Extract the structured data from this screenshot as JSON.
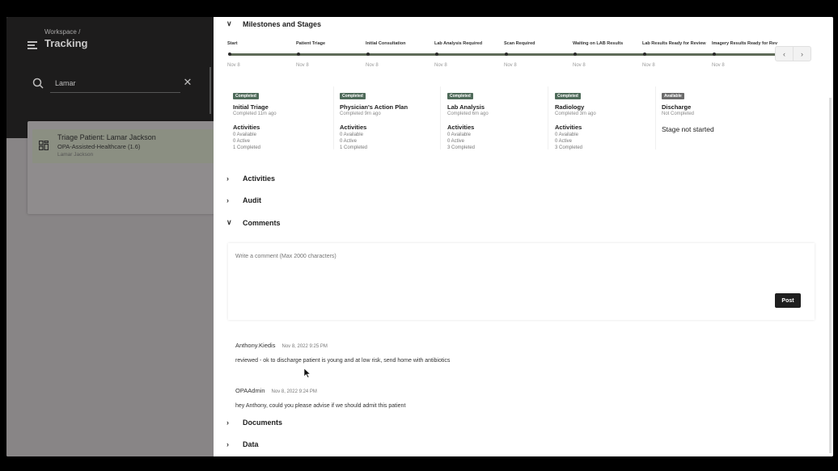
{
  "sidebar": {
    "breadcrumb": "Workspace /",
    "title": "Tracking",
    "search": {
      "value": "Lamar",
      "icon": "search-icon",
      "clear_icon": "close-icon"
    },
    "results": [
      {
        "title": "Triage Patient: Lamar Jackson",
        "process": "OPA-Assisted-Healthcare (1.6)",
        "user": "Lamar Jackson",
        "icon": "process-grid-icon"
      }
    ]
  },
  "main": {
    "milestones_section": {
      "label": "Milestones and Stages",
      "expanded": true
    },
    "milestones": [
      {
        "label": "Start",
        "date": "Nov 8"
      },
      {
        "label": "Patient Triage",
        "date": "Nov 8"
      },
      {
        "label": "Initial Consultation",
        "date": "Nov 8"
      },
      {
        "label": "Lab Analysis Required",
        "date": "Nov 8"
      },
      {
        "label": "Scan Required",
        "date": "Nov 8"
      },
      {
        "label": "Waiting on LAB Results",
        "date": "Nov 8"
      },
      {
        "label": "Lab Results Ready for Review",
        "date": "Nov 8"
      },
      {
        "label": "Imagery Results Ready for Rev",
        "date": "Nov 8"
      }
    ],
    "milestone_nav": {
      "prev_icon": "chevron-left-icon",
      "next_icon": "chevron-right-icon"
    },
    "stages": [
      {
        "badge": "Completed",
        "badge_color": "#4f6b5a",
        "name": "Initial Triage",
        "status": "Completed 11m ago",
        "activities_label": "Activities",
        "available": "0 Available",
        "active": "0 Active",
        "completed": "1 Completed"
      },
      {
        "badge": "Completed",
        "badge_color": "#4f6b5a",
        "name": "Physician's Action Plan",
        "status": "Completed 9m ago",
        "activities_label": "Activities",
        "available": "0 Available",
        "active": "0 Active",
        "completed": "1 Completed"
      },
      {
        "badge": "Completed",
        "badge_color": "#4f6b5a",
        "name": "Lab Analysis",
        "status": "Completed 6m ago",
        "activities_label": "Activities",
        "available": "0 Available",
        "active": "0 Active",
        "completed": "3 Completed"
      },
      {
        "badge": "Completed",
        "badge_color": "#4f6b5a",
        "name": "Radiology",
        "status": "Completed 3m ago",
        "activities_label": "Activities",
        "available": "0 Available",
        "active": "0 Active",
        "completed": "3 Completed"
      },
      {
        "badge": "Available",
        "badge_color": "#6b6b6b",
        "name": "Discharge",
        "status": "Not Completed",
        "not_started": "Stage not started"
      }
    ],
    "sections": {
      "activities": "Activities",
      "audit": "Audit",
      "comments": "Comments",
      "documents": "Documents",
      "data": "Data"
    },
    "comment_input": {
      "placeholder": "Write a comment (Max 2000 characters)",
      "value": ""
    },
    "post_label": "Post",
    "comments": [
      {
        "author": "Anthony.Kiedis",
        "time": "Nov 8, 2022 9:25 PM",
        "text": "reviewed - ok to discharge patient is young and at low risk, send home with antibiotics"
      },
      {
        "author": "OPAAdmin",
        "time": "Nov 8, 2022 9:24 PM",
        "text": "hey Anthony, could you please advise if we should admit this patient"
      }
    ]
  }
}
